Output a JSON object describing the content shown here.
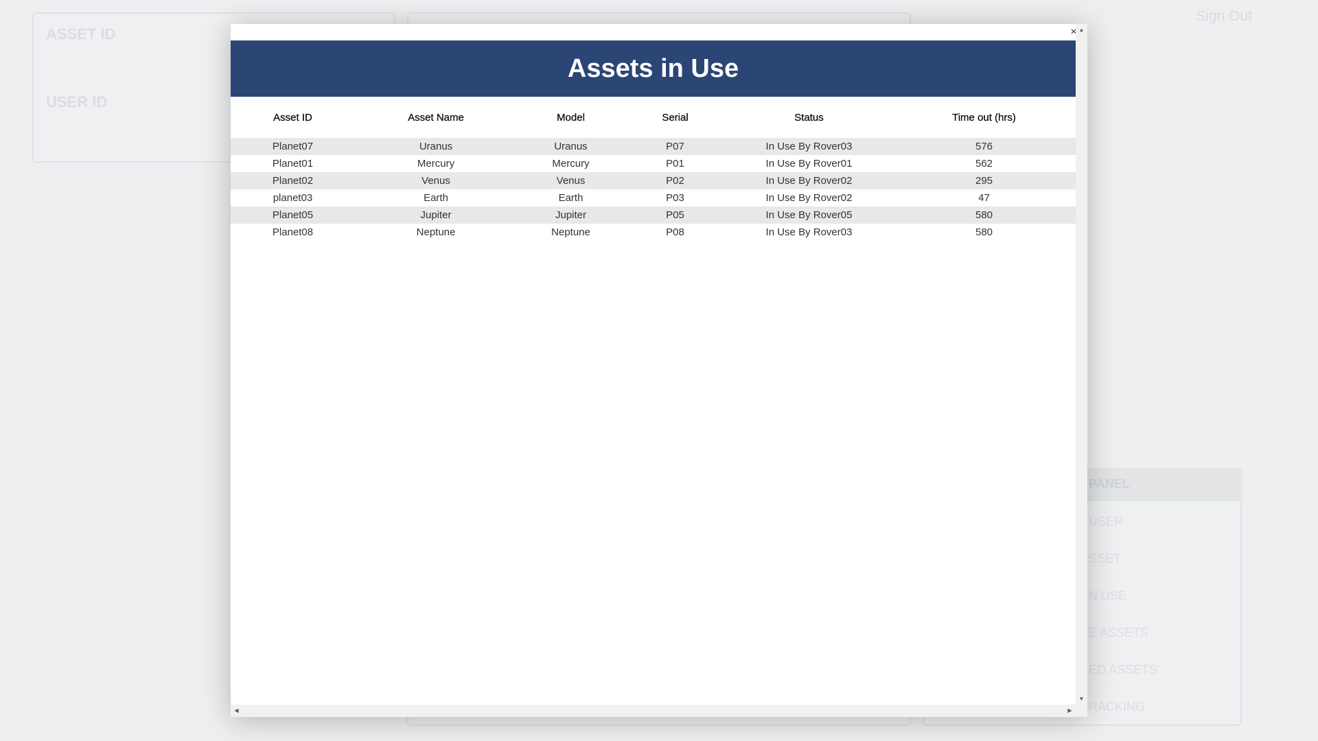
{
  "background": {
    "asset_id_label": "ASSET ID",
    "user_id_label": "USER ID",
    "sign_out": "Sign Out",
    "panel": {
      "title": "PANEL",
      "items": [
        "USER",
        "SSET",
        "N USE",
        "E ASSETS",
        "ED ASSETS",
        "RACKING"
      ]
    }
  },
  "modal": {
    "close_label": "×",
    "title": "Assets in Use",
    "columns": [
      "Asset ID",
      "Asset Name",
      "Model",
      "Serial",
      "Status",
      "Time out (hrs)"
    ],
    "rows": [
      [
        "Planet07",
        "Uranus",
        "Uranus",
        "P07",
        "In Use By Rover03",
        "576"
      ],
      [
        "Planet01",
        "Mercury",
        "Mercury",
        "P01",
        "In Use By Rover01",
        "562"
      ],
      [
        "Planet02",
        "Venus",
        "Venus",
        "P02",
        "In Use By Rover02",
        "295"
      ],
      [
        "planet03",
        "Earth",
        "Earth",
        "P03",
        "In Use By Rover02",
        "47"
      ],
      [
        "Planet05",
        "Jupiter",
        "Jupiter",
        "P05",
        "In Use By Rover05",
        "580"
      ],
      [
        "Planet08",
        "Neptune",
        "Neptune",
        "P08",
        "In Use By Rover03",
        "580"
      ]
    ]
  },
  "colors": {
    "header_bg": "#2b4575",
    "row_alt": "#e8e8ea",
    "page_bg": "#eeeff1"
  }
}
